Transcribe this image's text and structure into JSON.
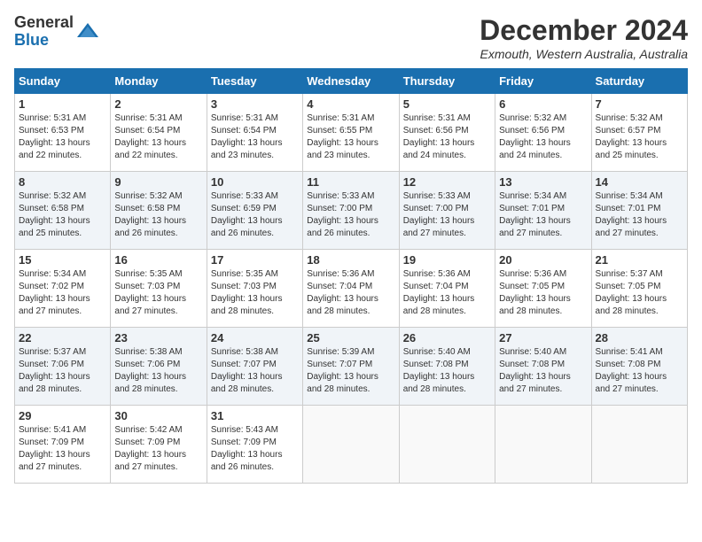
{
  "logo": {
    "general": "General",
    "blue": "Blue"
  },
  "title": {
    "month_year": "December 2024",
    "location": "Exmouth, Western Australia, Australia"
  },
  "headers": [
    "Sunday",
    "Monday",
    "Tuesday",
    "Wednesday",
    "Thursday",
    "Friday",
    "Saturday"
  ],
  "weeks": [
    [
      {
        "day": "1",
        "sunrise": "5:31 AM",
        "sunset": "6:53 PM",
        "daylight": "13 hours and 22 minutes."
      },
      {
        "day": "2",
        "sunrise": "5:31 AM",
        "sunset": "6:54 PM",
        "daylight": "13 hours and 22 minutes."
      },
      {
        "day": "3",
        "sunrise": "5:31 AM",
        "sunset": "6:54 PM",
        "daylight": "13 hours and 23 minutes."
      },
      {
        "day": "4",
        "sunrise": "5:31 AM",
        "sunset": "6:55 PM",
        "daylight": "13 hours and 23 minutes."
      },
      {
        "day": "5",
        "sunrise": "5:31 AM",
        "sunset": "6:56 PM",
        "daylight": "13 hours and 24 minutes."
      },
      {
        "day": "6",
        "sunrise": "5:32 AM",
        "sunset": "6:56 PM",
        "daylight": "13 hours and 24 minutes."
      },
      {
        "day": "7",
        "sunrise": "5:32 AM",
        "sunset": "6:57 PM",
        "daylight": "13 hours and 25 minutes."
      }
    ],
    [
      {
        "day": "8",
        "sunrise": "5:32 AM",
        "sunset": "6:58 PM",
        "daylight": "13 hours and 25 minutes."
      },
      {
        "day": "9",
        "sunrise": "5:32 AM",
        "sunset": "6:58 PM",
        "daylight": "13 hours and 26 minutes."
      },
      {
        "day": "10",
        "sunrise": "5:33 AM",
        "sunset": "6:59 PM",
        "daylight": "13 hours and 26 minutes."
      },
      {
        "day": "11",
        "sunrise": "5:33 AM",
        "sunset": "7:00 PM",
        "daylight": "13 hours and 26 minutes."
      },
      {
        "day": "12",
        "sunrise": "5:33 AM",
        "sunset": "7:00 PM",
        "daylight": "13 hours and 27 minutes."
      },
      {
        "day": "13",
        "sunrise": "5:34 AM",
        "sunset": "7:01 PM",
        "daylight": "13 hours and 27 minutes."
      },
      {
        "day": "14",
        "sunrise": "5:34 AM",
        "sunset": "7:01 PM",
        "daylight": "13 hours and 27 minutes."
      }
    ],
    [
      {
        "day": "15",
        "sunrise": "5:34 AM",
        "sunset": "7:02 PM",
        "daylight": "13 hours and 27 minutes."
      },
      {
        "day": "16",
        "sunrise": "5:35 AM",
        "sunset": "7:03 PM",
        "daylight": "13 hours and 27 minutes."
      },
      {
        "day": "17",
        "sunrise": "5:35 AM",
        "sunset": "7:03 PM",
        "daylight": "13 hours and 28 minutes."
      },
      {
        "day": "18",
        "sunrise": "5:36 AM",
        "sunset": "7:04 PM",
        "daylight": "13 hours and 28 minutes."
      },
      {
        "day": "19",
        "sunrise": "5:36 AM",
        "sunset": "7:04 PM",
        "daylight": "13 hours and 28 minutes."
      },
      {
        "day": "20",
        "sunrise": "5:36 AM",
        "sunset": "7:05 PM",
        "daylight": "13 hours and 28 minutes."
      },
      {
        "day": "21",
        "sunrise": "5:37 AM",
        "sunset": "7:05 PM",
        "daylight": "13 hours and 28 minutes."
      }
    ],
    [
      {
        "day": "22",
        "sunrise": "5:37 AM",
        "sunset": "7:06 PM",
        "daylight": "13 hours and 28 minutes."
      },
      {
        "day": "23",
        "sunrise": "5:38 AM",
        "sunset": "7:06 PM",
        "daylight": "13 hours and 28 minutes."
      },
      {
        "day": "24",
        "sunrise": "5:38 AM",
        "sunset": "7:07 PM",
        "daylight": "13 hours and 28 minutes."
      },
      {
        "day": "25",
        "sunrise": "5:39 AM",
        "sunset": "7:07 PM",
        "daylight": "13 hours and 28 minutes."
      },
      {
        "day": "26",
        "sunrise": "5:40 AM",
        "sunset": "7:08 PM",
        "daylight": "13 hours and 28 minutes."
      },
      {
        "day": "27",
        "sunrise": "5:40 AM",
        "sunset": "7:08 PM",
        "daylight": "13 hours and 27 minutes."
      },
      {
        "day": "28",
        "sunrise": "5:41 AM",
        "sunset": "7:08 PM",
        "daylight": "13 hours and 27 minutes."
      }
    ],
    [
      {
        "day": "29",
        "sunrise": "5:41 AM",
        "sunset": "7:09 PM",
        "daylight": "13 hours and 27 minutes."
      },
      {
        "day": "30",
        "sunrise": "5:42 AM",
        "sunset": "7:09 PM",
        "daylight": "13 hours and 27 minutes."
      },
      {
        "day": "31",
        "sunrise": "5:43 AM",
        "sunset": "7:09 PM",
        "daylight": "13 hours and 26 minutes."
      },
      null,
      null,
      null,
      null
    ]
  ]
}
